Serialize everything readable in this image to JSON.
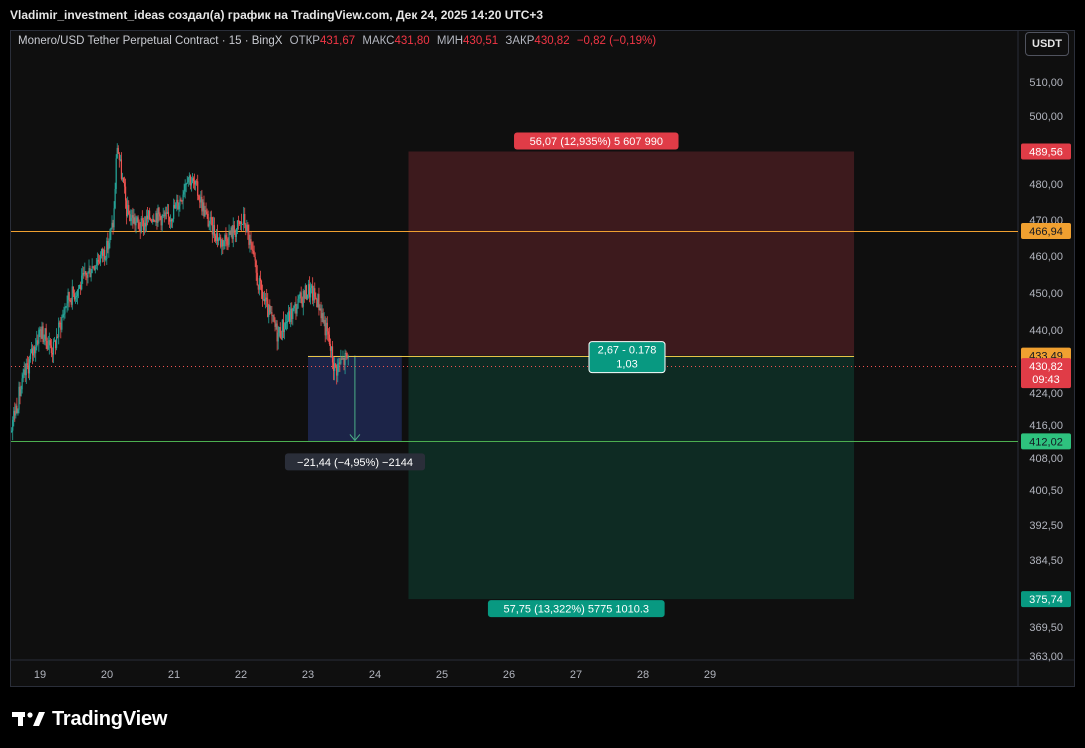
{
  "header": {
    "attribution": "Vladimir_investment_ideas создал(а) график на TradingView.com, Дек 24, 2025 14:20 UTC+3"
  },
  "legend": {
    "symbol": "Monero/USD Tether Perpetual Contract · 15 · BingX",
    "open_label": "ОТКР",
    "open": "431,67",
    "high_label": "МАКС",
    "high": "431,80",
    "low_label": "МИН",
    "low": "430,51",
    "close_label": "ЗАКР",
    "close": "430,82",
    "change": "−0,82 (−0,19%)"
  },
  "currency_button": "USDT",
  "footer": {
    "brand": "TradingView",
    "logo_icon": "tradingview-logo-icon"
  },
  "colors": {
    "up": "#26a69a",
    "down": "#ef5350",
    "orange": "#f0a030",
    "green_line": "#4caf50",
    "stop_zone": "#3d1a1d",
    "target_zone": "#0e2b23",
    "measure_zone": "#1c2448"
  },
  "chart_data": {
    "type": "candlestick",
    "symbol": "Monero/USD Tether Perpetual Contract",
    "interval": "15",
    "exchange": "BingX",
    "x_ticks": [
      "19",
      "20",
      "21",
      "22",
      "23",
      "24",
      "25",
      "26",
      "27",
      "28",
      "29"
    ],
    "y_ticks": [
      "363,00",
      "369,50",
      "376,50",
      "384,50",
      "392,50",
      "400,50",
      "408,00",
      "416,00",
      "424,00",
      "440,00",
      "450,00",
      "460,00",
      "470,00",
      "480,00",
      "500,00",
      "510,00"
    ],
    "approx_path": [
      [
        18.0,
        437
      ],
      [
        18.1,
        445
      ],
      [
        18.2,
        432
      ],
      [
        18.3,
        420
      ],
      [
        18.45,
        411
      ],
      [
        18.6,
        418
      ],
      [
        18.8,
        430
      ],
      [
        19.0,
        440
      ],
      [
        19.2,
        435
      ],
      [
        19.4,
        448
      ],
      [
        19.6,
        452
      ],
      [
        19.8,
        458
      ],
      [
        20.0,
        462
      ],
      [
        20.1,
        470
      ],
      [
        20.15,
        492
      ],
      [
        20.2,
        485
      ],
      [
        20.3,
        472
      ],
      [
        20.5,
        468
      ],
      [
        20.7,
        472
      ],
      [
        20.9,
        470
      ],
      [
        21.1,
        476
      ],
      [
        21.2,
        483
      ],
      [
        21.35,
        478
      ],
      [
        21.5,
        470
      ],
      [
        21.7,
        464
      ],
      [
        21.9,
        467
      ],
      [
        22.05,
        470
      ],
      [
        22.15,
        462
      ],
      [
        22.25,
        453
      ],
      [
        22.4,
        445
      ],
      [
        22.55,
        439
      ],
      [
        22.7,
        443
      ],
      [
        22.85,
        447
      ],
      [
        23.0,
        451
      ],
      [
        23.15,
        448
      ],
      [
        23.3,
        438
      ],
      [
        23.4,
        430
      ],
      [
        23.5,
        432
      ],
      [
        23.6,
        433
      ]
    ],
    "horizontal_levels": [
      {
        "price": 466.94,
        "label": "466,94",
        "color": "orange"
      },
      {
        "price": 412.02,
        "label": "412,02",
        "color": "green"
      }
    ],
    "last_price": {
      "value": "430,82",
      "countdown": "09:43"
    },
    "position_tool": {
      "entry": 433.49,
      "entry_label": "433,49",
      "stop": 489.56,
      "stop_label": "489,56",
      "target": 375.74,
      "target_label": "375,74",
      "stop_text": "56,07 (12,935%) 5 607 990",
      "target_text": "57,75 (13,322%) 5775 1010.3",
      "ratio_text_1": "2,67 - 0.178",
      "ratio_text_2": "1,03"
    },
    "measure": {
      "from": 433.49,
      "to": 412.02,
      "text": "−21,44 (−4,95%) −2144"
    }
  }
}
